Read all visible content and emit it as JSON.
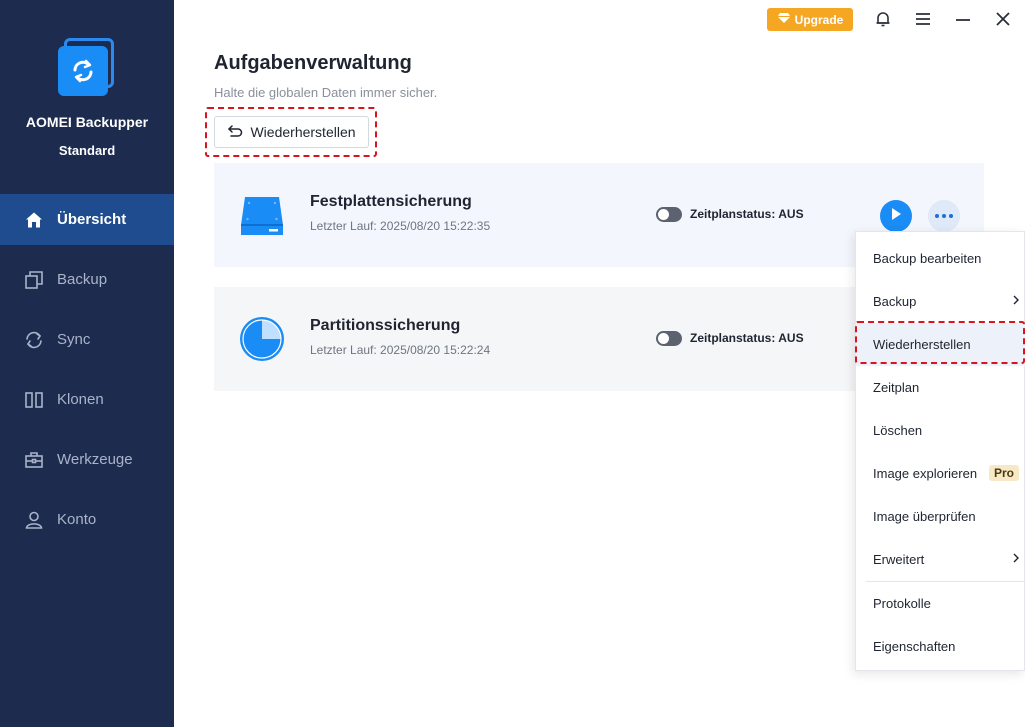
{
  "app": {
    "name": "AOMEI Backupper",
    "edition": "Standard"
  },
  "sidebar": {
    "items": [
      {
        "label": "Übersicht",
        "icon": "home-icon",
        "active": true
      },
      {
        "label": "Backup",
        "icon": "copy-icon",
        "active": false
      },
      {
        "label": "Sync",
        "icon": "sync-icon",
        "active": false
      },
      {
        "label": "Klonen",
        "icon": "clone-icon",
        "active": false
      },
      {
        "label": "Werkzeuge",
        "icon": "toolbox-icon",
        "active": false
      },
      {
        "label": "Konto",
        "icon": "user-icon",
        "active": false
      }
    ]
  },
  "titlebar": {
    "upgrade_label": "Upgrade"
  },
  "header": {
    "title": "Aufgabenverwaltung",
    "subtitle": "Halte die globalen Daten immer sicher.",
    "restore_label": "Wiederherstellen"
  },
  "tasks": [
    {
      "name": "Festplattensicherung",
      "last_run": "Letzter Lauf: 2025/08/20 15:22:35",
      "schedule_status": "Zeitplanstatus: AUS",
      "icon": "disk-icon"
    },
    {
      "name": "Partitionssicherung",
      "last_run": "Letzter Lauf: 2025/08/20 15:22:24",
      "schedule_status": "Zeitplanstatus: AUS",
      "icon": "partition-icon"
    }
  ],
  "context_menu": {
    "items": [
      {
        "label": "Backup bearbeiten"
      },
      {
        "label": "Backup"
      },
      {
        "label": "Wiederherstellen"
      },
      {
        "label": "Zeitplan"
      },
      {
        "label": "Löschen"
      },
      {
        "label": "Image explorieren"
      },
      {
        "label": "Image überprüfen"
      },
      {
        "label": "Erweitert"
      },
      {
        "label": "Protokolle"
      },
      {
        "label": "Eigenschaften"
      }
    ],
    "pro_badge": "Pro"
  },
  "colors": {
    "sidebar_bg": "#1d2b4f",
    "sidebar_active": "#1f4c8f",
    "accent": "#1a8cf5",
    "upgrade": "#f5a623",
    "highlight_dash": "#d9141e"
  }
}
